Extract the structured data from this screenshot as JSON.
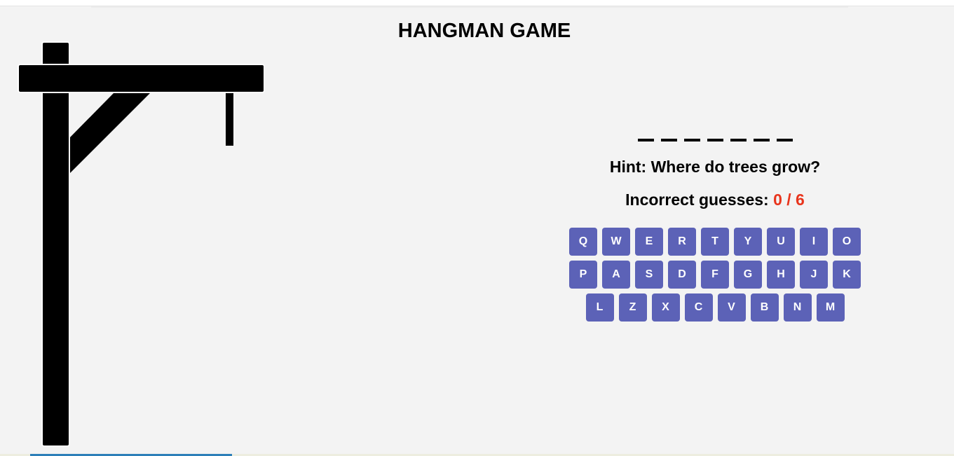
{
  "title": "HANGMAN GAME",
  "word": {
    "length": 7,
    "revealed": [
      "",
      "",
      "",
      "",
      "",
      "",
      ""
    ]
  },
  "hint": "Hint: Where do trees grow?",
  "guesses": {
    "label": "Incorrect guesses:",
    "count": "0 / 6"
  },
  "keyboard": {
    "rows": [
      [
        "Q",
        "W",
        "E",
        "R",
        "T",
        "Y",
        "U",
        "I",
        "O"
      ],
      [
        "P",
        "A",
        "S",
        "D",
        "F",
        "G",
        "H",
        "J",
        "K"
      ],
      [
        "L",
        "Z",
        "X",
        "C",
        "V",
        "B",
        "N",
        "M"
      ]
    ]
  },
  "colors": {
    "background": "#f3f3f3",
    "key_bg": "#5c62b7",
    "count": "#e8341c"
  }
}
